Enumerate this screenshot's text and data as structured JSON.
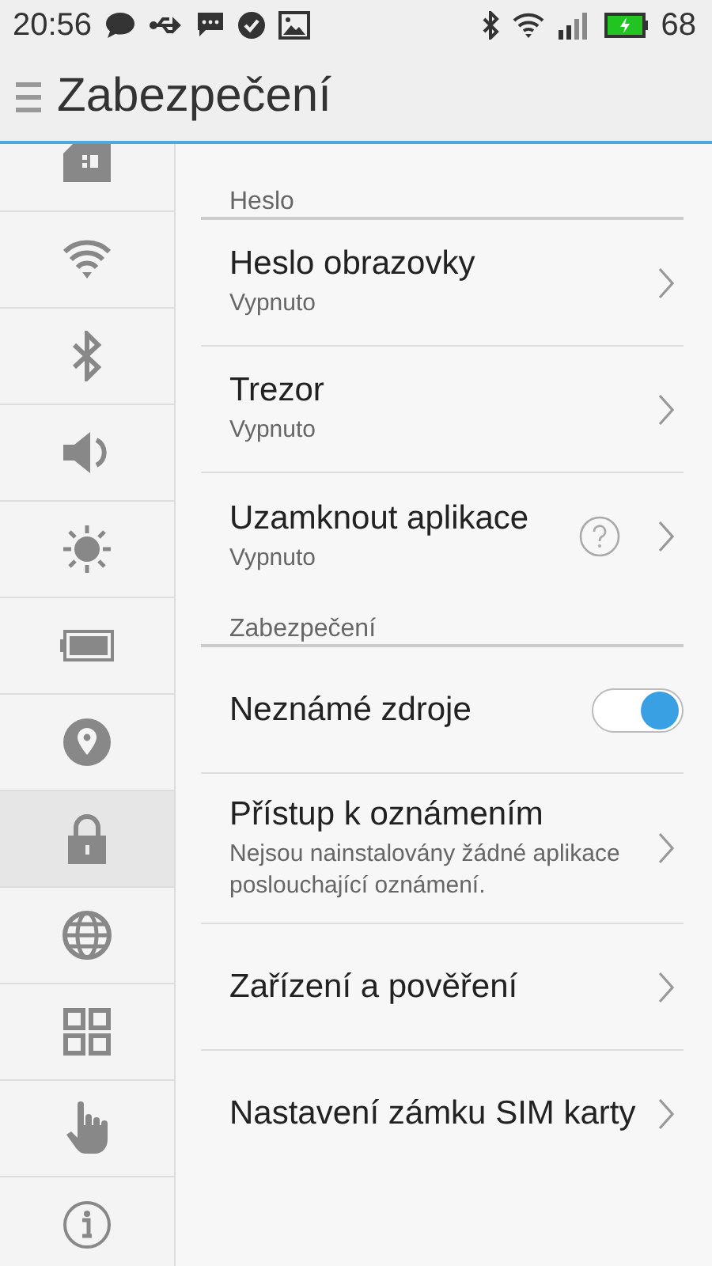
{
  "status_bar": {
    "time": "20:56",
    "battery": "68"
  },
  "header": {
    "title": "Zabezpečení"
  },
  "sidebar": {
    "items": [
      {
        "kind": "sim",
        "selected": false
      },
      {
        "kind": "wifi",
        "selected": false
      },
      {
        "kind": "bluetooth",
        "selected": false
      },
      {
        "kind": "sound",
        "selected": false
      },
      {
        "kind": "brightness",
        "selected": false
      },
      {
        "kind": "battery",
        "selected": false
      },
      {
        "kind": "location",
        "selected": false
      },
      {
        "kind": "lock",
        "selected": true
      },
      {
        "kind": "globe",
        "selected": false
      },
      {
        "kind": "apps",
        "selected": false
      },
      {
        "kind": "hand",
        "selected": false
      },
      {
        "kind": "info",
        "selected": false
      }
    ]
  },
  "sections": [
    {
      "title": "Heslo",
      "items": [
        {
          "kind": "link",
          "title": "Heslo obrazovky",
          "subtitle": "Vypnuto"
        },
        {
          "kind": "link",
          "title": "Trezor",
          "subtitle": "Vypnuto"
        },
        {
          "kind": "help",
          "title": "Uzamknout aplikace",
          "subtitle": "Vypnuto"
        }
      ]
    },
    {
      "title": "Zabezpečení",
      "items": [
        {
          "kind": "toggle",
          "title": "Neznámé zdroje",
          "on": true
        },
        {
          "kind": "link",
          "title": "Přístup k oznámením",
          "subtitle": "Nejsou nainstalovány žádné aplikace poslouchající oznámení."
        },
        {
          "kind": "link",
          "title": "Zařízení a pověření"
        },
        {
          "kind": "link",
          "title": "Nastavení zámku SIM karty"
        }
      ]
    }
  ]
}
